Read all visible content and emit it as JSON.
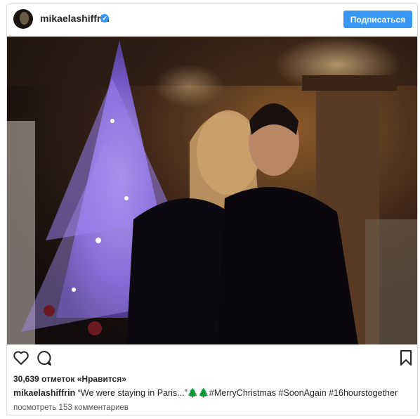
{
  "post": {
    "username": "mikaelashiffrin",
    "verified_icon": "verified-badge-icon",
    "follow_label": "Подписаться",
    "likes_text": "30,639 отметок «Нравится»",
    "caption_user": "mikaelashiffrin",
    "caption_text": "“We were staying in Paris...”🌲🌲#MerryChristmas #SoonAgain #16hourstogether",
    "view_comments": "посмотреть 153 комментариев"
  },
  "icons": {
    "like": "heart-icon",
    "comment": "comment-bubble-icon",
    "bookmark": "bookmark-icon"
  },
  "colors": {
    "accent": "#3897f0",
    "text": "#262626",
    "border": "#dbdbdb"
  }
}
